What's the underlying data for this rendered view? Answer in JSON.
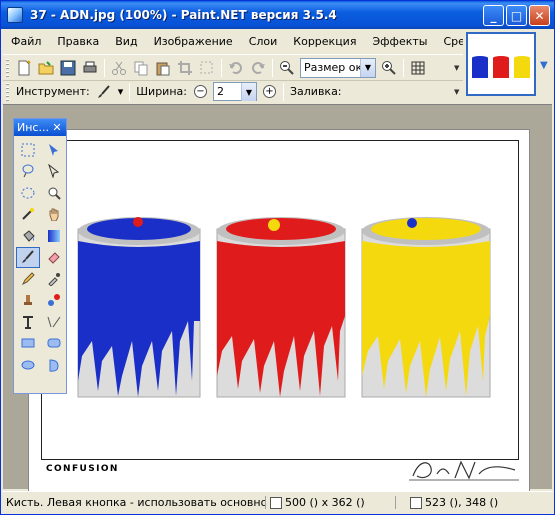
{
  "window": {
    "title": "37 - ADN.jpg (100%) - Paint.NET версия 3.5.4",
    "buttons": [
      "_",
      "□",
      "✕"
    ]
  },
  "menu": [
    "Файл",
    "Правка",
    "Вид",
    "Изображение",
    "Слои",
    "Коррекция",
    "Эффекты",
    "Средства"
  ],
  "toolbar": {
    "zoom_value": "Размер окна",
    "tool_label": "Инструмент:",
    "width_label": "Ширина:",
    "width_value": "2",
    "fill_label": "Заливка:"
  },
  "tools_panel": {
    "title": "Инс...",
    "close": "✕",
    "active_tool": "brush-tool"
  },
  "canvas": {
    "caption": "CONFUSION",
    "signature": "Dave Nitsche",
    "paint_colors": [
      "#1a2fc8",
      "#e01b1b",
      "#f4d90e"
    ]
  },
  "status": {
    "hint": "Кисть. Левая кнопка - использовать основной цвет",
    "image_size": "500 () x 362 ()",
    "cursor_pos": "523 (), 348 ()"
  }
}
